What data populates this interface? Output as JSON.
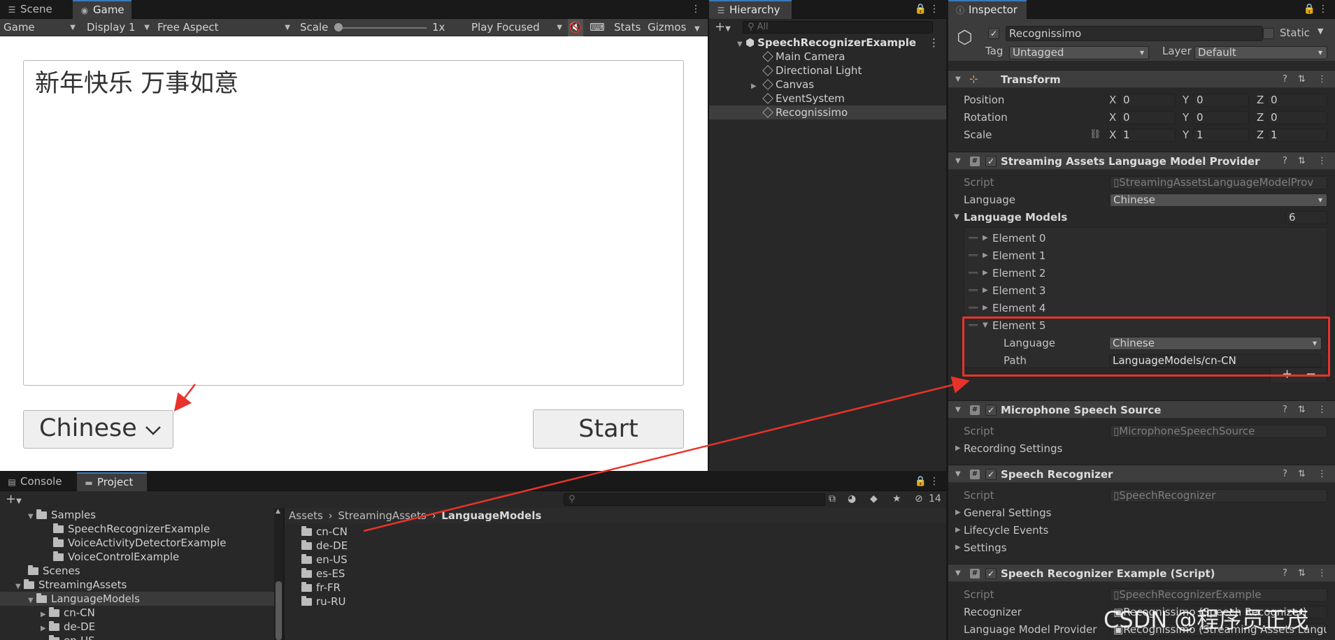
{
  "game": {
    "tabs": [
      {
        "label": "Scene",
        "icon": "scene-icon"
      },
      {
        "label": "Game",
        "icon": "game-icon"
      }
    ],
    "toolbar": {
      "mode": "Game",
      "display": "Display 1",
      "aspect": "Free Aspect",
      "scale_label": "Scale",
      "scale_value": "1x",
      "play_mode": "Play Focused",
      "stats": "Stats",
      "gizmos": "Gizmos"
    },
    "content": {
      "recognized_text": "新年快乐 万事如意",
      "language_dropdown": "Chinese",
      "start_button": "Start"
    }
  },
  "hierarchy": {
    "tab": "Hierarchy",
    "search_placeholder": "All",
    "items": [
      {
        "label": "SpeechRecognizerExample"
      },
      {
        "label": "Main Camera"
      },
      {
        "label": "Directional Light"
      },
      {
        "label": "Canvas"
      },
      {
        "label": "EventSystem"
      },
      {
        "label": "Recognissimo"
      }
    ]
  },
  "inspector": {
    "tab": "Inspector",
    "object_name": "Recognissimo",
    "static_label": "Static",
    "tag_label": "Tag",
    "tag_value": "Untagged",
    "layer_label": "Layer",
    "layer_value": "Default",
    "transform": {
      "title": "Transform",
      "position_label": "Position",
      "rotation_label": "Rotation",
      "scale_label": "Scale",
      "position": [
        "0",
        "0",
        "0"
      ],
      "rotation": [
        "0",
        "0",
        "0"
      ],
      "scale": [
        "1",
        "1",
        "1"
      ]
    },
    "slmp": {
      "title": "Streaming Assets Language Model Provider",
      "script_label": "Script",
      "script_value": "StreamingAssetsLanguageModelProv",
      "language_label": "Language",
      "language_value": "Chinese",
      "models_label": "Language Models",
      "models_count": "6",
      "elements": [
        "Element 0",
        "Element 1",
        "Element 2",
        "Element 3",
        "Element 4",
        "Element 5"
      ],
      "el5_language_label": "Language",
      "el5_language_value": "Chinese",
      "el5_path_label": "Path",
      "el5_path_value": "LanguageModels/cn-CN"
    },
    "mic": {
      "title": "Microphone Speech Source",
      "script_label": "Script",
      "script_value": "MicrophoneSpeechSource",
      "recording": "Recording Settings"
    },
    "sr": {
      "title": "Speech Recognizer",
      "script_label": "Script",
      "script_value": "SpeechRecognizer",
      "general": "General Settings",
      "lifecycle": "Lifecycle Events",
      "settings": "Settings"
    },
    "sre": {
      "title": "Speech Recognizer Example (Script)",
      "script_label": "Script",
      "script_value": "SpeechRecognizerExample",
      "recognizer_label": "Recognizer",
      "recognizer_value": "Recognissimo (Speech Recognizer)",
      "provider_label": "Language Model Provider",
      "provider_value": "Recognissimo (Streaming Assets Langu"
    }
  },
  "project": {
    "tabs": [
      {
        "label": "Console",
        "icon": "console-icon"
      },
      {
        "label": "Project",
        "icon": "folder-icon"
      }
    ],
    "hidden_count": "14",
    "breadcrumb": [
      "Assets",
      "StreamingAssets",
      "LanguageModels"
    ],
    "tree": [
      {
        "label": "Samples"
      },
      {
        "label": "SpeechRecognizerExample"
      },
      {
        "label": "VoiceActivityDetectorExample"
      },
      {
        "label": "VoiceControlExample"
      },
      {
        "label": "Scenes"
      },
      {
        "label": "StreamingAssets"
      },
      {
        "label": "LanguageModels"
      },
      {
        "label": "cn-CN"
      },
      {
        "label": "de-DE"
      },
      {
        "label": "en-US"
      }
    ],
    "folders": [
      "cn-CN",
      "de-DE",
      "en-US",
      "es-ES",
      "fr-FR",
      "ru-RU"
    ]
  },
  "watermark": "CSDN @程序员正茂",
  "colors": {
    "accent": "#3a79bb",
    "annotation": "#e8332a"
  }
}
